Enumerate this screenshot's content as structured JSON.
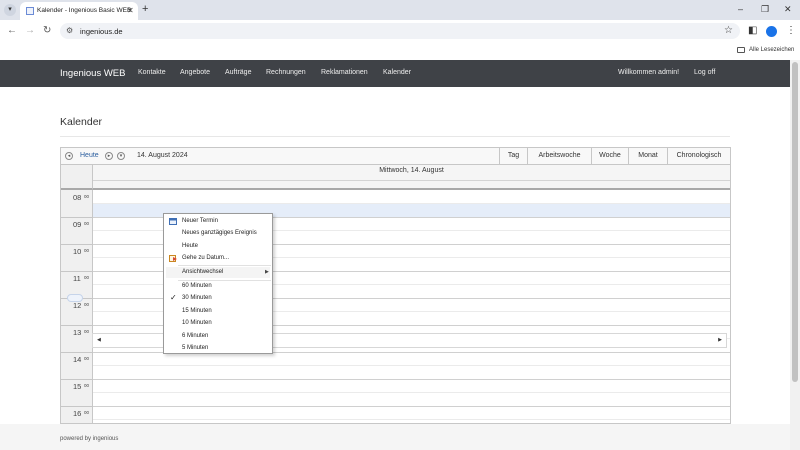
{
  "browser": {
    "tab_title": "Kalender - Ingenious Basic WEB",
    "url": "ingenious.de",
    "bookmarks_label": "Alle Lesezeichen"
  },
  "app": {
    "brand": "Ingenious WEB",
    "nav": [
      "Kontakte",
      "Angebote",
      "Aufträge",
      "Rechnungen",
      "Reklamationen",
      "Kalender"
    ],
    "welcome": "Willkommen admin!",
    "logout": "Log off"
  },
  "page": {
    "title": "Kalender"
  },
  "calendar": {
    "today_label": "Heute",
    "date": "14. August 2024",
    "views": [
      "Tag",
      "Arbeitswoche",
      "Woche",
      "Monat",
      "Chronologisch"
    ],
    "day_header": "Mittwoch, 14. August",
    "hours": [
      "08",
      "09",
      "10",
      "11",
      "12",
      "13",
      "14",
      "15",
      "16"
    ],
    "minute_suffix": "00"
  },
  "context_menu": {
    "items": [
      "Neuer Termin",
      "Neues ganztägiges Ereignis",
      "Heute",
      "Gehe zu Datum...",
      "Ansichtwechsel",
      "60 Minuten",
      "30 Minuten",
      "15 Minuten",
      "10 Minuten",
      "6 Minuten",
      "5 Minuten"
    ],
    "checked_item": "30 Minuten"
  },
  "footer": {
    "text": "powered by ingenious"
  },
  "colors": {
    "navbar": "#3f4247",
    "link": "#2a5d9e",
    "selection": "#e5edf9"
  }
}
